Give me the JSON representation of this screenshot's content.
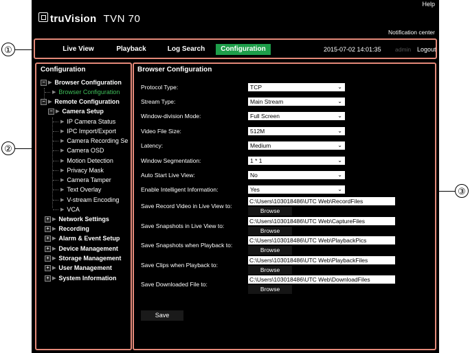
{
  "header": {
    "help_label": "Help",
    "brand": "truVision",
    "model": "TVN 70",
    "notification_label": "Notification center"
  },
  "nav": {
    "tabs": [
      {
        "label": "Live View",
        "active": false
      },
      {
        "label": "Playback",
        "active": false
      },
      {
        "label": "Log Search",
        "active": false
      },
      {
        "label": "Configuration",
        "active": true
      }
    ],
    "datetime": "2015-07-02 14:01:35",
    "user": "admin",
    "logout_label": "Logout"
  },
  "sidebar": {
    "title": "Configuration",
    "items": [
      {
        "label": "Browser Configuration",
        "bold": true,
        "expander": "minus"
      },
      {
        "label": "Browser Configuration",
        "selected": true
      },
      {
        "label": "Remote Configuration",
        "bold": true,
        "expander": "minus"
      },
      {
        "label": "Camera Setup",
        "bold": true,
        "expander": "minus"
      },
      {
        "label": "IP Camera Status"
      },
      {
        "label": "IPC Import/Export"
      },
      {
        "label": "Camera Recording Se"
      },
      {
        "label": "Camera OSD"
      },
      {
        "label": "Motion Detection"
      },
      {
        "label": "Privacy Mask"
      },
      {
        "label": "Camera Tamper"
      },
      {
        "label": "Text Overlay"
      },
      {
        "label": "V-stream Encoding"
      },
      {
        "label": "VCA"
      },
      {
        "label": "Network Settings",
        "bold": true,
        "expander": "plus"
      },
      {
        "label": "Recording",
        "bold": true,
        "expander": "plus"
      },
      {
        "label": "Alarm & Event Setup",
        "bold": true,
        "expander": "plus"
      },
      {
        "label": "Device Management",
        "bold": true,
        "expander": "plus"
      },
      {
        "label": "Storage Management",
        "bold": true,
        "expander": "plus"
      },
      {
        "label": "User Management",
        "bold": true,
        "expander": "plus"
      },
      {
        "label": "System Information",
        "bold": true,
        "expander": "plus"
      }
    ]
  },
  "main": {
    "title": "Browser Configuration",
    "selects": [
      {
        "label": "Protocol Type:",
        "value": "TCP"
      },
      {
        "label": "Stream Type:",
        "value": "Main Stream"
      },
      {
        "label": "Window-division Mode:",
        "value": "Full Screen"
      },
      {
        "label": "Video File Size:",
        "value": "512M"
      },
      {
        "label": "Latency:",
        "value": "Medium"
      },
      {
        "label": "Window Segmentation:",
        "value": "1 * 1"
      },
      {
        "label": "Auto Start Live View:",
        "value": "No"
      },
      {
        "label": "Enable Intelligent Information:",
        "value": "Yes"
      }
    ],
    "paths": [
      {
        "label": "Save Record Video in Live View to:",
        "value": "C:\\Users\\103018486\\UTC Web\\RecordFiles"
      },
      {
        "label": "Save Snapshots in Live View to:",
        "value": "C:\\Users\\103018486\\UTC Web\\CaptureFiles"
      },
      {
        "label": "Save Snapshots when Playback to:",
        "value": "C:\\Users\\103018486\\UTC Web\\PlaybackPics"
      },
      {
        "label": "Save Clips when Playback to:",
        "value": "C:\\Users\\103018486\\UTC Web\\PlaybackFiles"
      },
      {
        "label": "Save Downloaded File to:",
        "value": "C:\\Users\\103018486\\UTC Web\\DownloadFiles"
      }
    ],
    "browse_label": "Browse",
    "save_label": "Save"
  },
  "callouts": [
    "①",
    "②",
    "③"
  ],
  "colors": {
    "accent": "#1e9e4a",
    "callout_border": "#e58a7a",
    "background": "#000000",
    "selected_tree": "#3fbf5a"
  }
}
